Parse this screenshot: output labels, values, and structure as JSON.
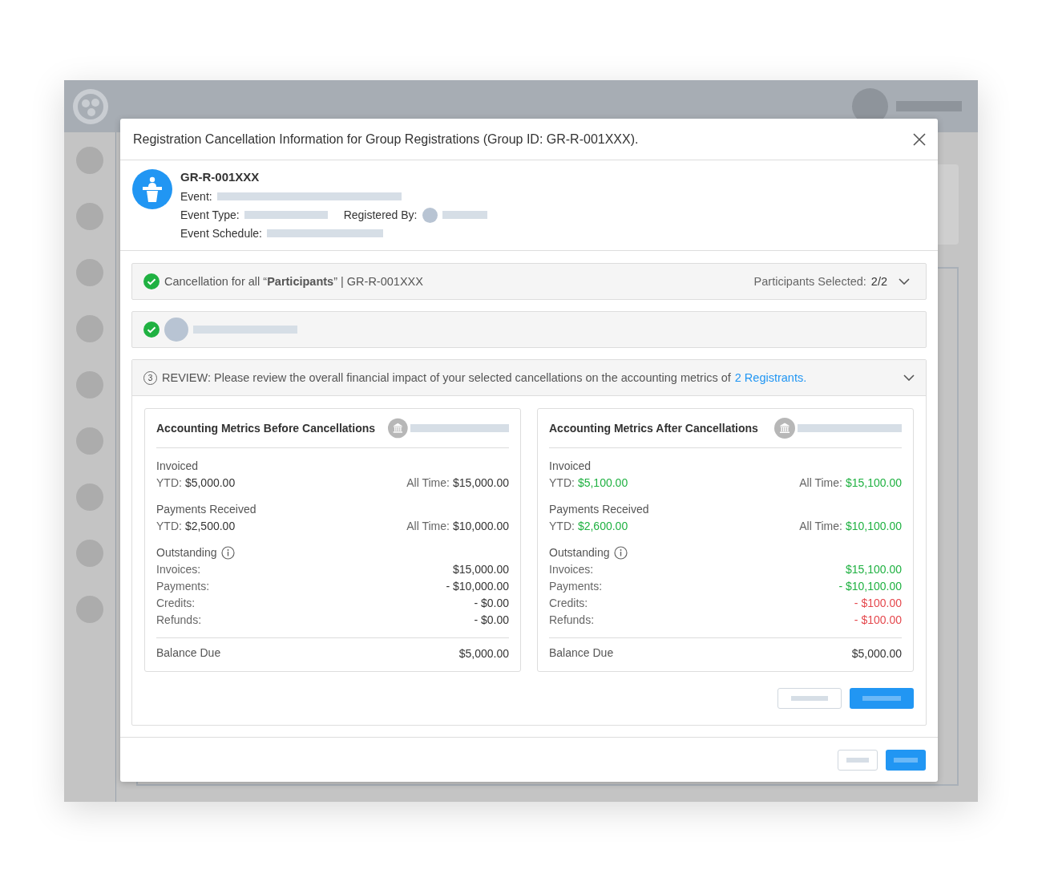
{
  "dialog": {
    "title": "Registration Cancellation Information for Group Registrations (Group ID: GR-R-001XXX)."
  },
  "registration": {
    "id": "GR-R-001XXX",
    "event_label": "Event:",
    "event_type_label": "Event Type:",
    "registered_by_label": "Registered By:",
    "schedule_label": "Event Schedule:"
  },
  "participants_section": {
    "checked": true,
    "text": "Cancellation for all “**Participants**” | GR-R-001XXX",
    "selected_label": "Participants Selected:",
    "selected_value": "2/2"
  },
  "participant_row": {
    "checked": true
  },
  "review_section": {
    "step": "3",
    "text": "REVIEW: Please review the overall financial impact of your selected cancellations on the accounting metrics of",
    "link": "2 Registrants."
  },
  "panels": [
    {
      "title": "Accounting Metrics Before Cancellations",
      "groups": [
        {
          "title": "Invoiced",
          "ytd": {
            "label": "YTD:",
            "value": "$5,000.00",
            "color": "#333333"
          },
          "all_time": {
            "label": "All Time:",
            "value": "$15,000.00",
            "color": "#333333"
          }
        },
        {
          "title": "Payments Received",
          "ytd": {
            "label": "YTD:",
            "value": "$2,500.00",
            "color": "#333333"
          },
          "all_time": {
            "label": "All Time:",
            "value": "$10,000.00",
            "color": "#333333"
          }
        }
      ],
      "outstanding_title": "Outstanding",
      "outstanding": [
        {
          "label": "Invoices:",
          "value": "$15,000.00",
          "color": "#333333"
        },
        {
          "label": "Payments:",
          "value": "- $10,000.00",
          "color": "#333333"
        },
        {
          "label": "Credits:",
          "value": "- $0.00",
          "color": "#333333"
        },
        {
          "label": "Refunds:",
          "value": "- $0.00",
          "color": "#333333"
        }
      ],
      "balance_label": "Balance Due",
      "balance_value": "$5,000.00"
    },
    {
      "title": "Accounting Metrics After Cancellations",
      "groups": [
        {
          "title": "Invoiced",
          "ytd": {
            "label": "YTD:",
            "value": "$5,100.00",
            "color": "#1fb141"
          },
          "all_time": {
            "label": "All Time:",
            "value": "$15,100.00",
            "color": "#1fb141"
          }
        },
        {
          "title": "Payments Received",
          "ytd": {
            "label": "YTD:",
            "value": "$2,600.00",
            "color": "#1fb141"
          },
          "all_time": {
            "label": "All Time:",
            "value": "$10,100.00",
            "color": "#1fb141"
          }
        }
      ],
      "outstanding_title": "Outstanding",
      "outstanding": [
        {
          "label": "Invoices:",
          "value": "$15,100.00",
          "color": "#1fb141"
        },
        {
          "label": "Payments:",
          "value": "- $10,100.00",
          "color": "#1fb141"
        },
        {
          "label": "Credits:",
          "value": "- $100.00",
          "color": "#e5484d"
        },
        {
          "label": "Refunds:",
          "value": "- $100.00",
          "color": "#e5484d"
        }
      ],
      "balance_label": "Balance Due",
      "balance_value": "$5,000.00"
    }
  ]
}
